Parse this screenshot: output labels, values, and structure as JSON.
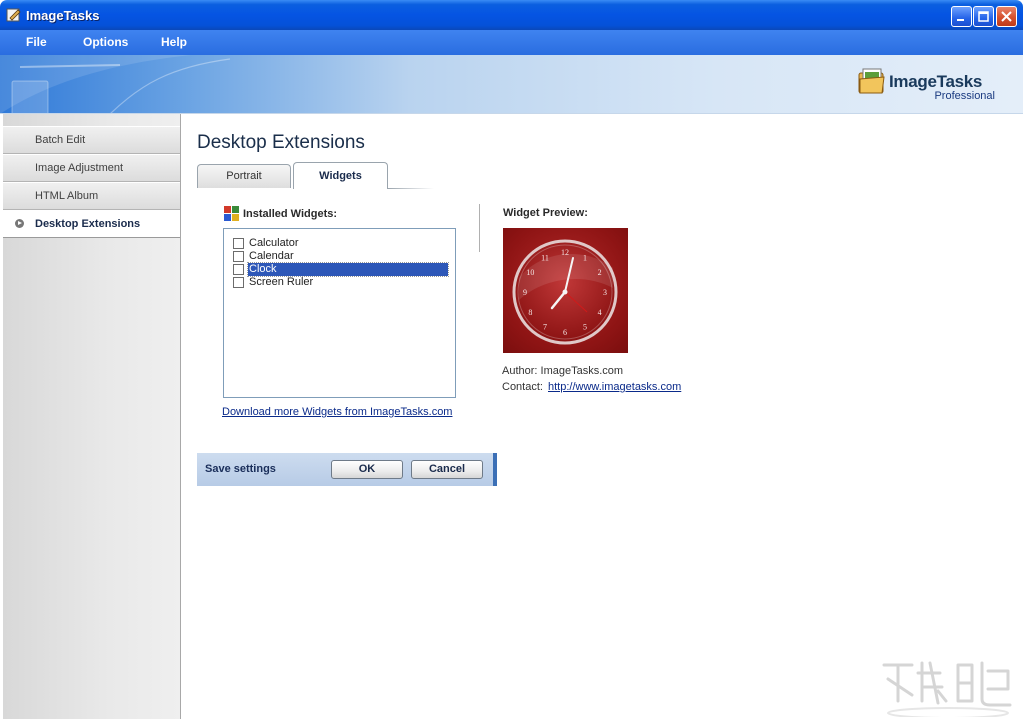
{
  "window": {
    "title": "ImageTasks"
  },
  "menu": {
    "items": [
      "File",
      "Options",
      "Help"
    ]
  },
  "logo": {
    "name": "ImageTasks",
    "edition": "Professional"
  },
  "sidebar": {
    "items": [
      {
        "label": "Batch Edit",
        "active": false
      },
      {
        "label": "Image Adjustment",
        "active": false
      },
      {
        "label": "HTML Album",
        "active": false
      },
      {
        "label": "Desktop Extensions",
        "active": true
      }
    ]
  },
  "main": {
    "page_title": "Desktop Extensions",
    "tabs": [
      {
        "label": "Portrait",
        "active": false
      },
      {
        "label": "Widgets",
        "active": true
      }
    ],
    "installed_label": "Installed Widgets:",
    "widgets": [
      {
        "label": "Calculator",
        "checked": false,
        "selected": false
      },
      {
        "label": "Calendar",
        "checked": false,
        "selected": false
      },
      {
        "label": "Clock",
        "checked": false,
        "selected": true
      },
      {
        "label": "Screen Ruler",
        "checked": false,
        "selected": false
      }
    ],
    "download_link": "Download more Widgets from ImageTasks.com",
    "preview_label": "Widget Preview:",
    "author_text": "Author: ImageTasks.com",
    "contact_prefix": "Contact:",
    "contact_link": "http://www.imagetasks.com",
    "clock_numbers": [
      "12",
      "1",
      "2",
      "3",
      "4",
      "5",
      "6",
      "7",
      "8",
      "9",
      "10",
      "11"
    ]
  },
  "save_bar": {
    "label": "Save settings",
    "ok": "OK",
    "cancel": "Cancel"
  },
  "colors": {
    "title_bar": "#0554e3",
    "accent": "#3b6fb6",
    "preview_bg": "#8e1414",
    "selection": "#2d57b8"
  }
}
